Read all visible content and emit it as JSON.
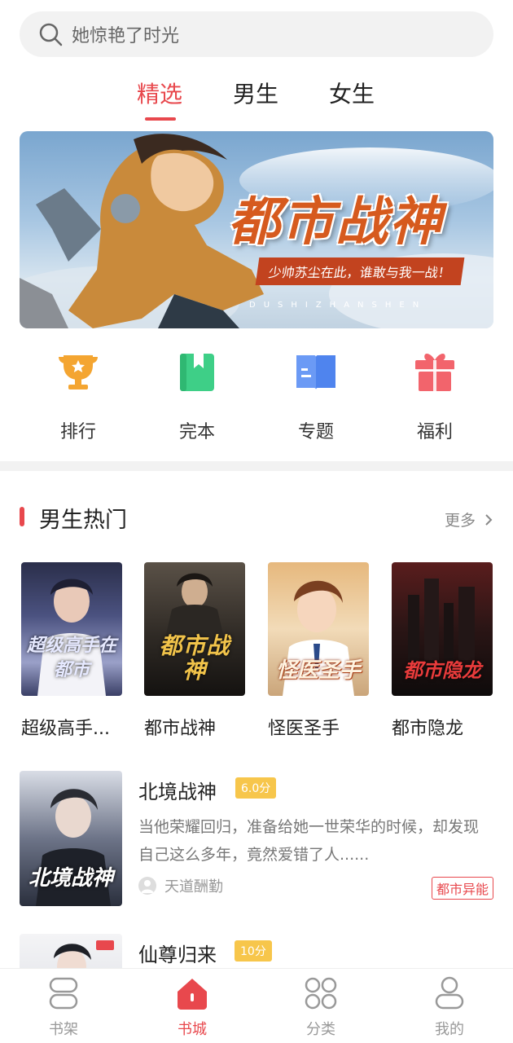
{
  "search": {
    "placeholder": "她惊艳了时光",
    "icon": "search-icon"
  },
  "tabs": [
    {
      "label": "精选",
      "active": true
    },
    {
      "label": "男生",
      "active": false
    },
    {
      "label": "女生",
      "active": false
    }
  ],
  "banner": {
    "title": "都市战神",
    "subtitle": "少帅苏尘在此，谁敢与我一战！",
    "pinyin": "DUSHIZHANSHEN"
  },
  "quick": [
    {
      "label": "排行",
      "icon": "trophy-icon",
      "color": "#f4a531"
    },
    {
      "label": "完本",
      "icon": "bookmark-book-icon",
      "color": "#3ecf87"
    },
    {
      "label": "专题",
      "icon": "open-book-icon",
      "color": "#5b8ef0"
    },
    {
      "label": "福利",
      "icon": "gift-icon",
      "color": "#f2646c"
    }
  ],
  "section": {
    "title": "男生热门",
    "more": "更多"
  },
  "books": [
    {
      "title": "超级高手...",
      "cover_text": "超级高手在都市"
    },
    {
      "title": "都市战神",
      "cover_text": "都市战神"
    },
    {
      "title": "怪医圣手",
      "cover_text": "怪医圣手"
    },
    {
      "title": "都市隐龙",
      "cover_text": "都市隐龙"
    }
  ],
  "list": [
    {
      "title": "北境战神",
      "score": "6.0分",
      "desc": "当他荣耀回归，准备给她一世荣华的时候，却发现自己这么多年，竟然爱错了人......",
      "author": "天道酬勤",
      "tag": "都市异能",
      "cover_text": "北境战神"
    },
    {
      "title": "仙尊归来",
      "score": "10分"
    }
  ],
  "bottom_nav": [
    {
      "label": "书架",
      "icon": "bookshelf-icon",
      "active": false
    },
    {
      "label": "书城",
      "icon": "home-icon",
      "active": true
    },
    {
      "label": "分类",
      "icon": "category-icon",
      "active": false
    },
    {
      "label": "我的",
      "icon": "profile-icon",
      "active": false
    }
  ],
  "colors": {
    "accent": "#e8484d",
    "score": "#f7c64b"
  }
}
